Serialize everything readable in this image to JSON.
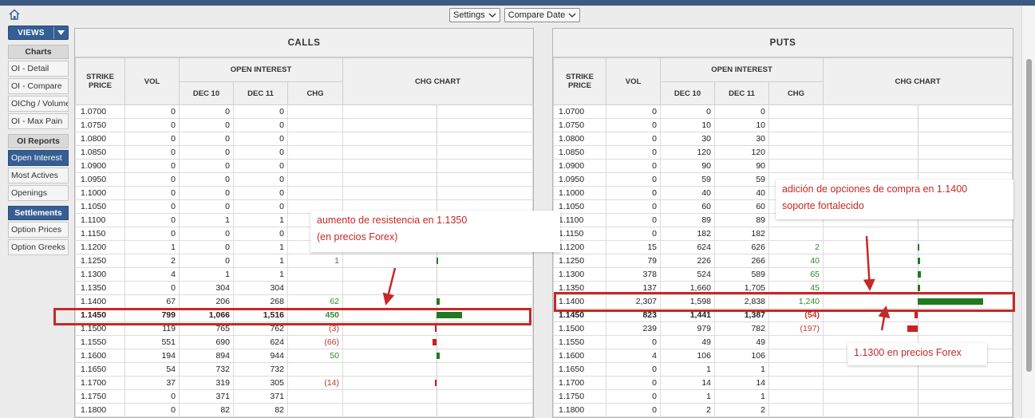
{
  "toolbar": {
    "settings_label": "Settings",
    "compare_label": "Compare Date"
  },
  "sidebar": {
    "views_label": "VIEWS",
    "sections": [
      {
        "header": "Charts",
        "items": [
          "OI - Detail",
          "OI - Compare",
          "OIChg / Volume",
          "OI - Max Pain"
        ]
      },
      {
        "header": "OI Reports",
        "items": [
          "Open Interest",
          "Most Actives",
          "Openings"
        ]
      },
      {
        "header": "Settlements",
        "items": [
          "Option Prices",
          "Option Greeks"
        ]
      }
    ],
    "active_item": "Open Interest"
  },
  "headers": {
    "strike": "STRIKE PRICE",
    "vol": "VOL",
    "open_interest": "OPEN INTEREST",
    "dec10": "DEC 10",
    "dec11": "DEC 11",
    "chg": "CHG",
    "chg_chart": "CHG CHART"
  },
  "calls": {
    "title": "CALLS",
    "bold_strike": "1.1450",
    "rows": [
      {
        "strike": "1.0700",
        "vol": "0",
        "dec10": "0",
        "dec11": "0",
        "chg": "",
        "chg_value": 0
      },
      {
        "strike": "1.0750",
        "vol": "0",
        "dec10": "0",
        "dec11": "0",
        "chg": "",
        "chg_value": 0
      },
      {
        "strike": "1.0800",
        "vol": "0",
        "dec10": "0",
        "dec11": "0",
        "chg": "",
        "chg_value": 0
      },
      {
        "strike": "1.0850",
        "vol": "0",
        "dec10": "0",
        "dec11": "0",
        "chg": "",
        "chg_value": 0
      },
      {
        "strike": "1.0900",
        "vol": "0",
        "dec10": "0",
        "dec11": "0",
        "chg": "",
        "chg_value": 0
      },
      {
        "strike": "1.0950",
        "vol": "0",
        "dec10": "0",
        "dec11": "0",
        "chg": "",
        "chg_value": 0
      },
      {
        "strike": "1.1000",
        "vol": "0",
        "dec10": "0",
        "dec11": "0",
        "chg": "",
        "chg_value": 0
      },
      {
        "strike": "1.1050",
        "vol": "0",
        "dec10": "0",
        "dec11": "0",
        "chg": "",
        "chg_value": 0
      },
      {
        "strike": "1.1100",
        "vol": "0",
        "dec10": "1",
        "dec11": "1",
        "chg": "",
        "chg_value": 0
      },
      {
        "strike": "1.1150",
        "vol": "0",
        "dec10": "0",
        "dec11": "0",
        "chg": "",
        "chg_value": 0
      },
      {
        "strike": "1.1200",
        "vol": "1",
        "dec10": "0",
        "dec11": "1",
        "chg": "",
        "chg_value": 0
      },
      {
        "strike": "1.1250",
        "vol": "2",
        "dec10": "0",
        "dec11": "1",
        "chg": "1",
        "chg_value": 1
      },
      {
        "strike": "1.1300",
        "vol": "4",
        "dec10": "1",
        "dec11": "1",
        "chg": "",
        "chg_value": 0
      },
      {
        "strike": "1.1350",
        "vol": "0",
        "dec10": "304",
        "dec11": "304",
        "chg": "",
        "chg_value": 0
      },
      {
        "strike": "1.1400",
        "vol": "67",
        "dec10": "206",
        "dec11": "268",
        "chg": "62",
        "chg_value": 62
      },
      {
        "strike": "1.1450",
        "vol": "799",
        "dec10": "1,066",
        "dec11": "1,516",
        "chg": "450",
        "chg_value": 450
      },
      {
        "strike": "1.1500",
        "vol": "119",
        "dec10": "765",
        "dec11": "762",
        "chg": "(3)",
        "chg_value": -3
      },
      {
        "strike": "1.1550",
        "vol": "551",
        "dec10": "690",
        "dec11": "624",
        "chg": "(66)",
        "chg_value": -66
      },
      {
        "strike": "1.1600",
        "vol": "194",
        "dec10": "894",
        "dec11": "944",
        "chg": "50",
        "chg_value": 50
      },
      {
        "strike": "1.1650",
        "vol": "54",
        "dec10": "732",
        "dec11": "732",
        "chg": "",
        "chg_value": 0
      },
      {
        "strike": "1.1700",
        "vol": "37",
        "dec10": "319",
        "dec11": "305",
        "chg": "(14)",
        "chg_value": -14
      },
      {
        "strike": "1.1750",
        "vol": "0",
        "dec10": "371",
        "dec11": "371",
        "chg": "",
        "chg_value": 0
      },
      {
        "strike": "1.1800",
        "vol": "0",
        "dec10": "82",
        "dec11": "82",
        "chg": "",
        "chg_value": 0
      }
    ]
  },
  "puts": {
    "title": "PUTS",
    "bold_strike": "1.1450",
    "rows": [
      {
        "strike": "1.0700",
        "vol": "0",
        "dec10": "0",
        "dec11": "0",
        "chg": "",
        "chg_value": 0
      },
      {
        "strike": "1.0750",
        "vol": "0",
        "dec10": "10",
        "dec11": "10",
        "chg": "",
        "chg_value": 0
      },
      {
        "strike": "1.0800",
        "vol": "0",
        "dec10": "30",
        "dec11": "30",
        "chg": "",
        "chg_value": 0
      },
      {
        "strike": "1.0850",
        "vol": "0",
        "dec10": "120",
        "dec11": "120",
        "chg": "",
        "chg_value": 0
      },
      {
        "strike": "1.0900",
        "vol": "0",
        "dec10": "90",
        "dec11": "90",
        "chg": "",
        "chg_value": 0
      },
      {
        "strike": "1.0950",
        "vol": "0",
        "dec10": "59",
        "dec11": "59",
        "chg": "",
        "chg_value": 0
      },
      {
        "strike": "1.1000",
        "vol": "0",
        "dec10": "40",
        "dec11": "40",
        "chg": "",
        "chg_value": 0
      },
      {
        "strike": "1.1050",
        "vol": "0",
        "dec10": "60",
        "dec11": "60",
        "chg": "",
        "chg_value": 0
      },
      {
        "strike": "1.1100",
        "vol": "0",
        "dec10": "89",
        "dec11": "89",
        "chg": "",
        "chg_value": 0
      },
      {
        "strike": "1.1150",
        "vol": "0",
        "dec10": "182",
        "dec11": "182",
        "chg": "",
        "chg_value": 0
      },
      {
        "strike": "1.1200",
        "vol": "15",
        "dec10": "624",
        "dec11": "626",
        "chg": "2",
        "chg_value": 2
      },
      {
        "strike": "1.1250",
        "vol": "79",
        "dec10": "226",
        "dec11": "266",
        "chg": "40",
        "chg_value": 40
      },
      {
        "strike": "1.1300",
        "vol": "378",
        "dec10": "524",
        "dec11": "589",
        "chg": "65",
        "chg_value": 65
      },
      {
        "strike": "1.1350",
        "vol": "137",
        "dec10": "1,660",
        "dec11": "1,705",
        "chg": "45",
        "chg_value": 45
      },
      {
        "strike": "1.1400",
        "vol": "2,307",
        "dec10": "1,598",
        "dec11": "2,838",
        "chg": "1,240",
        "chg_value": 1240
      },
      {
        "strike": "1.1450",
        "vol": "823",
        "dec10": "1,441",
        "dec11": "1,387",
        "chg": "(54)",
        "chg_value": -54
      },
      {
        "strike": "1.1500",
        "vol": "239",
        "dec10": "979",
        "dec11": "782",
        "chg": "(197)",
        "chg_value": -197
      },
      {
        "strike": "1.1550",
        "vol": "0",
        "dec10": "49",
        "dec11": "49",
        "chg": "",
        "chg_value": 0
      },
      {
        "strike": "1.1600",
        "vol": "4",
        "dec10": "106",
        "dec11": "106",
        "chg": "",
        "chg_value": 0
      },
      {
        "strike": "1.1650",
        "vol": "0",
        "dec10": "1",
        "dec11": "1",
        "chg": "",
        "chg_value": 0
      },
      {
        "strike": "1.1700",
        "vol": "0",
        "dec10": "14",
        "dec11": "14",
        "chg": "",
        "chg_value": 0
      },
      {
        "strike": "1.1750",
        "vol": "0",
        "dec10": "1",
        "dec11": "1",
        "chg": "",
        "chg_value": 0
      },
      {
        "strike": "1.1800",
        "vol": "0",
        "dec10": "2",
        "dec11": "2",
        "chg": "",
        "chg_value": 0
      }
    ]
  },
  "annotations": {
    "calls_note": [
      "aumento de resistencia en 1.1350",
      "(en precios Forex)"
    ],
    "puts_note": [
      "adición de opciones de compra en 1.1400",
      "soporte fortalecido"
    ],
    "forex_note": "1.1300 en precios Forex",
    "color": "#c62828"
  },
  "colors": {
    "accent": "#355f94",
    "positive": "#1f7a1f",
    "negative": "#cc1f1f"
  }
}
